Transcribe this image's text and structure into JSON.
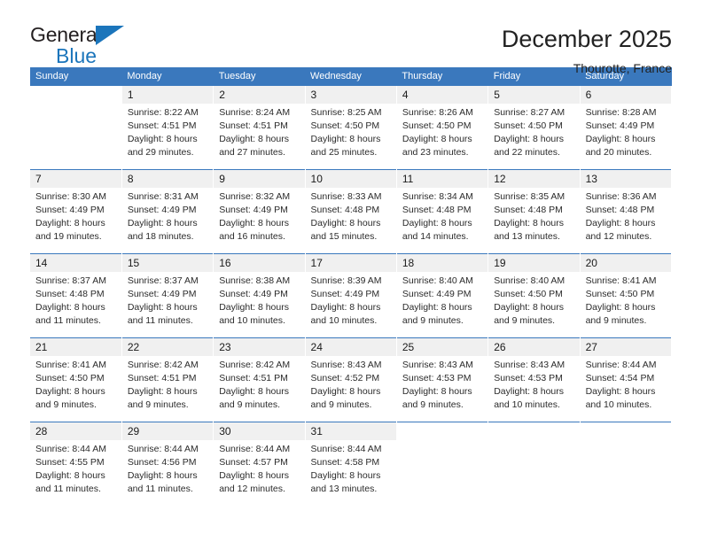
{
  "brand": {
    "word1": "General",
    "word2": "Blue",
    "triangle_color": "#1b75bb"
  },
  "header": {
    "title": "December 2025",
    "subtitle": "Thourotte, France",
    "accent_color": "#3a78bd",
    "daynum_band_color": "#f0f0f0"
  },
  "weekday_headers": [
    "Sunday",
    "Monday",
    "Tuesday",
    "Wednesday",
    "Thursday",
    "Friday",
    "Saturday"
  ],
  "weeks": [
    {
      "days": [
        {
          "num": "",
          "l1": "",
          "l2": "",
          "l3": "",
          "l4": ""
        },
        {
          "num": "1",
          "l1": "Sunrise: 8:22 AM",
          "l2": "Sunset: 4:51 PM",
          "l3": "Daylight: 8 hours",
          "l4": "and 29 minutes."
        },
        {
          "num": "2",
          "l1": "Sunrise: 8:24 AM",
          "l2": "Sunset: 4:51 PM",
          "l3": "Daylight: 8 hours",
          "l4": "and 27 minutes."
        },
        {
          "num": "3",
          "l1": "Sunrise: 8:25 AM",
          "l2": "Sunset: 4:50 PM",
          "l3": "Daylight: 8 hours",
          "l4": "and 25 minutes."
        },
        {
          "num": "4",
          "l1": "Sunrise: 8:26 AM",
          "l2": "Sunset: 4:50 PM",
          "l3": "Daylight: 8 hours",
          "l4": "and 23 minutes."
        },
        {
          "num": "5",
          "l1": "Sunrise: 8:27 AM",
          "l2": "Sunset: 4:50 PM",
          "l3": "Daylight: 8 hours",
          "l4": "and 22 minutes."
        },
        {
          "num": "6",
          "l1": "Sunrise: 8:28 AM",
          "l2": "Sunset: 4:49 PM",
          "l3": "Daylight: 8 hours",
          "l4": "and 20 minutes."
        }
      ]
    },
    {
      "days": [
        {
          "num": "7",
          "l1": "Sunrise: 8:30 AM",
          "l2": "Sunset: 4:49 PM",
          "l3": "Daylight: 8 hours",
          "l4": "and 19 minutes."
        },
        {
          "num": "8",
          "l1": "Sunrise: 8:31 AM",
          "l2": "Sunset: 4:49 PM",
          "l3": "Daylight: 8 hours",
          "l4": "and 18 minutes."
        },
        {
          "num": "9",
          "l1": "Sunrise: 8:32 AM",
          "l2": "Sunset: 4:49 PM",
          "l3": "Daylight: 8 hours",
          "l4": "and 16 minutes."
        },
        {
          "num": "10",
          "l1": "Sunrise: 8:33 AM",
          "l2": "Sunset: 4:48 PM",
          "l3": "Daylight: 8 hours",
          "l4": "and 15 minutes."
        },
        {
          "num": "11",
          "l1": "Sunrise: 8:34 AM",
          "l2": "Sunset: 4:48 PM",
          "l3": "Daylight: 8 hours",
          "l4": "and 14 minutes."
        },
        {
          "num": "12",
          "l1": "Sunrise: 8:35 AM",
          "l2": "Sunset: 4:48 PM",
          "l3": "Daylight: 8 hours",
          "l4": "and 13 minutes."
        },
        {
          "num": "13",
          "l1": "Sunrise: 8:36 AM",
          "l2": "Sunset: 4:48 PM",
          "l3": "Daylight: 8 hours",
          "l4": "and 12 minutes."
        }
      ]
    },
    {
      "days": [
        {
          "num": "14",
          "l1": "Sunrise: 8:37 AM",
          "l2": "Sunset: 4:48 PM",
          "l3": "Daylight: 8 hours",
          "l4": "and 11 minutes."
        },
        {
          "num": "15",
          "l1": "Sunrise: 8:37 AM",
          "l2": "Sunset: 4:49 PM",
          "l3": "Daylight: 8 hours",
          "l4": "and 11 minutes."
        },
        {
          "num": "16",
          "l1": "Sunrise: 8:38 AM",
          "l2": "Sunset: 4:49 PM",
          "l3": "Daylight: 8 hours",
          "l4": "and 10 minutes."
        },
        {
          "num": "17",
          "l1": "Sunrise: 8:39 AM",
          "l2": "Sunset: 4:49 PM",
          "l3": "Daylight: 8 hours",
          "l4": "and 10 minutes."
        },
        {
          "num": "18",
          "l1": "Sunrise: 8:40 AM",
          "l2": "Sunset: 4:49 PM",
          "l3": "Daylight: 8 hours",
          "l4": "and 9 minutes."
        },
        {
          "num": "19",
          "l1": "Sunrise: 8:40 AM",
          "l2": "Sunset: 4:50 PM",
          "l3": "Daylight: 8 hours",
          "l4": "and 9 minutes."
        },
        {
          "num": "20",
          "l1": "Sunrise: 8:41 AM",
          "l2": "Sunset: 4:50 PM",
          "l3": "Daylight: 8 hours",
          "l4": "and 9 minutes."
        }
      ]
    },
    {
      "days": [
        {
          "num": "21",
          "l1": "Sunrise: 8:41 AM",
          "l2": "Sunset: 4:50 PM",
          "l3": "Daylight: 8 hours",
          "l4": "and 9 minutes."
        },
        {
          "num": "22",
          "l1": "Sunrise: 8:42 AM",
          "l2": "Sunset: 4:51 PM",
          "l3": "Daylight: 8 hours",
          "l4": "and 9 minutes."
        },
        {
          "num": "23",
          "l1": "Sunrise: 8:42 AM",
          "l2": "Sunset: 4:51 PM",
          "l3": "Daylight: 8 hours",
          "l4": "and 9 minutes."
        },
        {
          "num": "24",
          "l1": "Sunrise: 8:43 AM",
          "l2": "Sunset: 4:52 PM",
          "l3": "Daylight: 8 hours",
          "l4": "and 9 minutes."
        },
        {
          "num": "25",
          "l1": "Sunrise: 8:43 AM",
          "l2": "Sunset: 4:53 PM",
          "l3": "Daylight: 8 hours",
          "l4": "and 9 minutes."
        },
        {
          "num": "26",
          "l1": "Sunrise: 8:43 AM",
          "l2": "Sunset: 4:53 PM",
          "l3": "Daylight: 8 hours",
          "l4": "and 10 minutes."
        },
        {
          "num": "27",
          "l1": "Sunrise: 8:44 AM",
          "l2": "Sunset: 4:54 PM",
          "l3": "Daylight: 8 hours",
          "l4": "and 10 minutes."
        }
      ]
    },
    {
      "days": [
        {
          "num": "28",
          "l1": "Sunrise: 8:44 AM",
          "l2": "Sunset: 4:55 PM",
          "l3": "Daylight: 8 hours",
          "l4": "and 11 minutes."
        },
        {
          "num": "29",
          "l1": "Sunrise: 8:44 AM",
          "l2": "Sunset: 4:56 PM",
          "l3": "Daylight: 8 hours",
          "l4": "and 11 minutes."
        },
        {
          "num": "30",
          "l1": "Sunrise: 8:44 AM",
          "l2": "Sunset: 4:57 PM",
          "l3": "Daylight: 8 hours",
          "l4": "and 12 minutes."
        },
        {
          "num": "31",
          "l1": "Sunrise: 8:44 AM",
          "l2": "Sunset: 4:58 PM",
          "l3": "Daylight: 8 hours",
          "l4": "and 13 minutes."
        },
        {
          "num": "",
          "l1": "",
          "l2": "",
          "l3": "",
          "l4": ""
        },
        {
          "num": "",
          "l1": "",
          "l2": "",
          "l3": "",
          "l4": ""
        },
        {
          "num": "",
          "l1": "",
          "l2": "",
          "l3": "",
          "l4": ""
        }
      ]
    }
  ]
}
